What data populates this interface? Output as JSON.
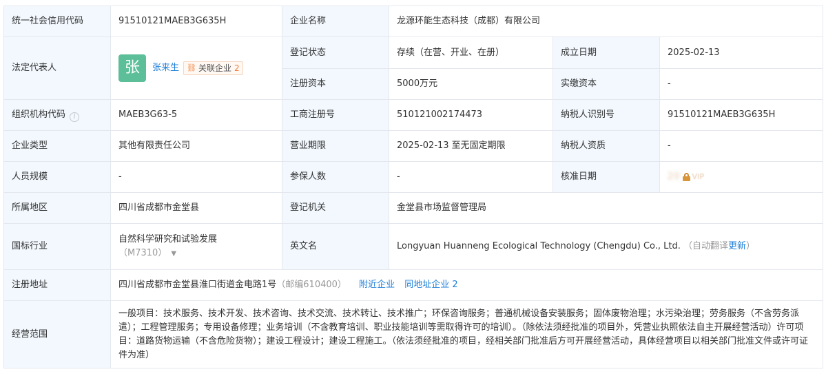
{
  "rows": {
    "credit_code": {
      "label": "统一社会信用代码",
      "value": "91510121MAEB3G635H"
    },
    "company_name": {
      "label": "企业名称",
      "value": "龙源环能生态科技（成都）有限公司"
    },
    "legal_rep": {
      "label": "法定代表人",
      "avatar_char": "张",
      "avatar_color": "#5cbf99",
      "name": "张来生",
      "related_label": "关联企业",
      "related_count": "2",
      "related_icon": "link-nodes-icon"
    },
    "reg_status": {
      "label": "登记状态",
      "value": "存续（在营、开业、在册）"
    },
    "established": {
      "label": "成立日期",
      "value": "2025-02-13"
    },
    "reg_capital": {
      "label": "注册资本",
      "value": "5000万元"
    },
    "paid_capital": {
      "label": "实缴资本",
      "value": "-"
    },
    "org_code": {
      "label": "组织机构代码",
      "value": "MAEB3G63-5",
      "info_icon": "i"
    },
    "biz_reg_no": {
      "label": "工商注册号",
      "value": "510121002174473"
    },
    "taxpayer_id": {
      "label": "纳税人识别号",
      "value": "91510121MAEB3G635H"
    },
    "company_type": {
      "label": "企业类型",
      "value": "其他有限责任公司"
    },
    "biz_term": {
      "label": "营业期限",
      "value": "2025-02-13 至无固定期限"
    },
    "taxpayer_qual": {
      "label": "纳税人资质",
      "value": "-"
    },
    "staff_size": {
      "label": "人员规模",
      "value": "-"
    },
    "insured": {
      "label": "参保人数",
      "value": "-"
    },
    "approval_date": {
      "label": "核准日期",
      "vip_text": "VIP"
    },
    "region": {
      "label": "所属地区",
      "value": "四川省成都市金堂县"
    },
    "reg_authority": {
      "label": "登记机关",
      "value": "金堂县市场监督管理局"
    },
    "industry": {
      "label": "国标行业",
      "value": "自然科学研究和试验发展",
      "code": "（M7310）"
    },
    "english_name": {
      "label": "英文名",
      "value": "Longyuan Huanneng Ecological Technology (Chengdu) Co., Ltd.",
      "auto_note": "（自动翻译",
      "update_link": "更新",
      "close_paren": "）"
    },
    "reg_address": {
      "label": "注册地址",
      "value": "四川省成都市金堂县淮口街道金电路1号",
      "postcode": "（邮编610400）",
      "nearby_link": "附近企业",
      "same_addr_link": "同地址企业",
      "same_addr_count": "2"
    },
    "biz_scope": {
      "label": "经营范围",
      "value": "一般项目：技术服务、技术开发、技术咨询、技术交流、技术转让、技术推广；环保咨询服务；普通机械设备安装服务；固体废物治理；水污染治理；劳务服务（不含劳务派遣）；工程管理服务；专用设备修理；业务培训（不含教育培训、职业技能培训等需取得许可的培训）。（除依法须经批准的项目外，凭营业执照依法自主开展经营活动）许可项目：道路货物运输（不含危险货物）；建设工程设计；建设工程施工。（依法须经批准的项目，经相关部门批准后方可开展经营活动，具体经营项目以相关部门批准文件或许可证件为准）"
    }
  }
}
